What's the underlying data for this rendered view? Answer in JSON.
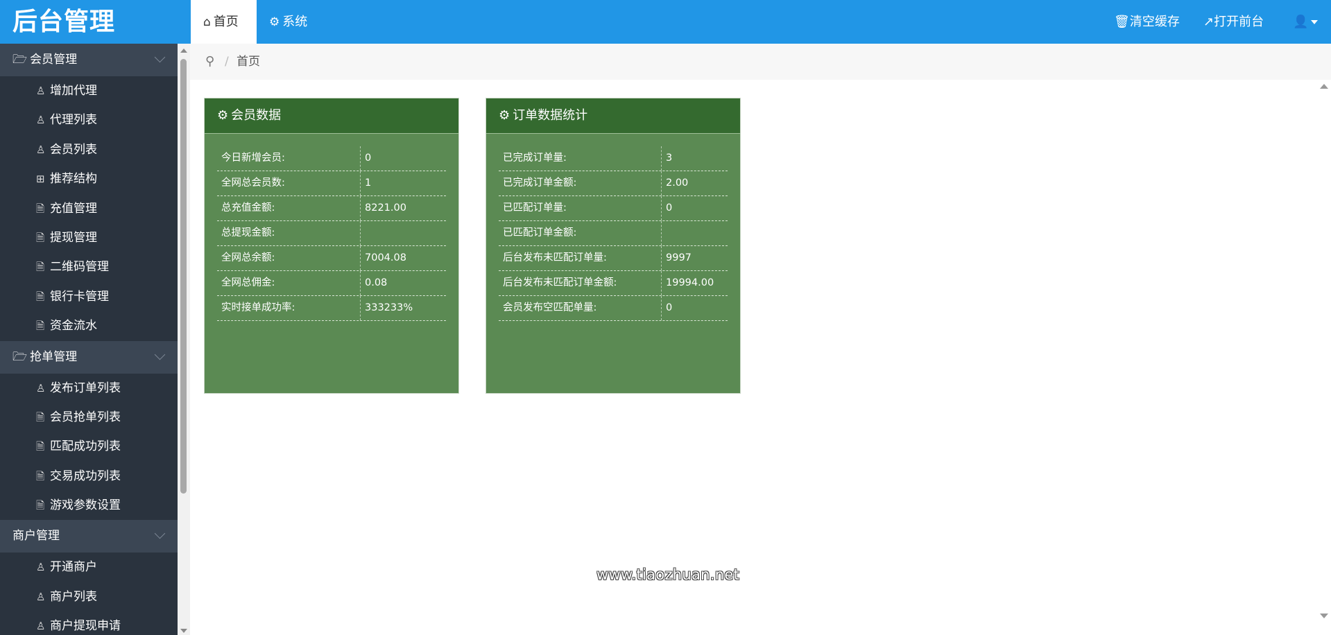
{
  "app": {
    "title": "后台管理"
  },
  "nav": {
    "tabs": [
      {
        "label": "首页",
        "icon": "home-icon",
        "active": true
      },
      {
        "label": "系统",
        "icon": "gear-icon",
        "active": false
      }
    ],
    "right": [
      {
        "label": "清空缓存",
        "icon": "trash-icon"
      },
      {
        "label": "打开前台",
        "icon": "external-link-icon"
      },
      {
        "label": "",
        "icon": "user-icon"
      }
    ]
  },
  "sidebar": {
    "groups": [
      {
        "label": "会员管理",
        "icon": "folder-open-icon",
        "items": [
          {
            "label": "增加代理",
            "icon": "user-icon"
          },
          {
            "label": "代理列表",
            "icon": "user-icon"
          },
          {
            "label": "会员列表",
            "icon": "user-icon"
          },
          {
            "label": "推荐结构",
            "icon": "grid-icon"
          },
          {
            "label": "充值管理",
            "icon": "document-icon"
          },
          {
            "label": "提现管理",
            "icon": "document-icon"
          },
          {
            "label": "二维码管理",
            "icon": "document-icon"
          },
          {
            "label": "银行卡管理",
            "icon": "document-icon"
          },
          {
            "label": "资金流水",
            "icon": "document-icon"
          }
        ]
      },
      {
        "label": "抢单管理",
        "icon": "folder-open-icon",
        "items": [
          {
            "label": "发布订单列表",
            "icon": "user-icon"
          },
          {
            "label": "会员抢单列表",
            "icon": "document-icon"
          },
          {
            "label": "匹配成功列表",
            "icon": "document-icon"
          },
          {
            "label": "交易成功列表",
            "icon": "document-icon"
          },
          {
            "label": "游戏参数设置",
            "icon": "document-icon"
          }
        ]
      },
      {
        "label": "商户管理",
        "icon": "",
        "items": [
          {
            "label": "开通商户",
            "icon": "user-icon"
          },
          {
            "label": "商户列表",
            "icon": "user-icon"
          },
          {
            "label": "商户提现申请",
            "icon": "user-icon"
          }
        ]
      }
    ]
  },
  "breadcrumb": {
    "icon": "location-pin-icon",
    "separator": "/",
    "current": "首页"
  },
  "panels": {
    "member": {
      "title": "会员数据",
      "icon": "gear-icon",
      "rows": [
        {
          "label": "今日新增会员:",
          "value": "0"
        },
        {
          "label": "全网总会员数:",
          "value": "1"
        },
        {
          "label": "总充值金额:",
          "value": "8221.00"
        },
        {
          "label": "总提现金额:",
          "value": ""
        },
        {
          "label": "全网总余额:",
          "value": "7004.08"
        },
        {
          "label": "全网总佣金:",
          "value": "0.08"
        },
        {
          "label": "实时接单成功率:",
          "value": "333233%"
        }
      ]
    },
    "orders": {
      "title": "订单数据统计",
      "icon": "gear-icon",
      "rows": [
        {
          "label": "已完成订单量:",
          "value": "3"
        },
        {
          "label": "已完成订单金额:",
          "value": "2.00"
        },
        {
          "label": "已匹配订单量:",
          "value": "0"
        },
        {
          "label": "已匹配订单金额:",
          "value": ""
        },
        {
          "label": "后台发布未匹配订单量:",
          "value": "9997"
        },
        {
          "label": "后台发布未匹配订单金额:",
          "value": "19994.00"
        },
        {
          "label": "会员发布空匹配单量:",
          "value": "0"
        }
      ]
    }
  },
  "watermark": "www.tiaozhuan.net",
  "colors": {
    "topbar": "#2196e6",
    "sidebar": "#2a333e",
    "sidebar_group": "#3b4654",
    "panel_head": "#346a2f",
    "panel_body": "#5b8a53"
  }
}
